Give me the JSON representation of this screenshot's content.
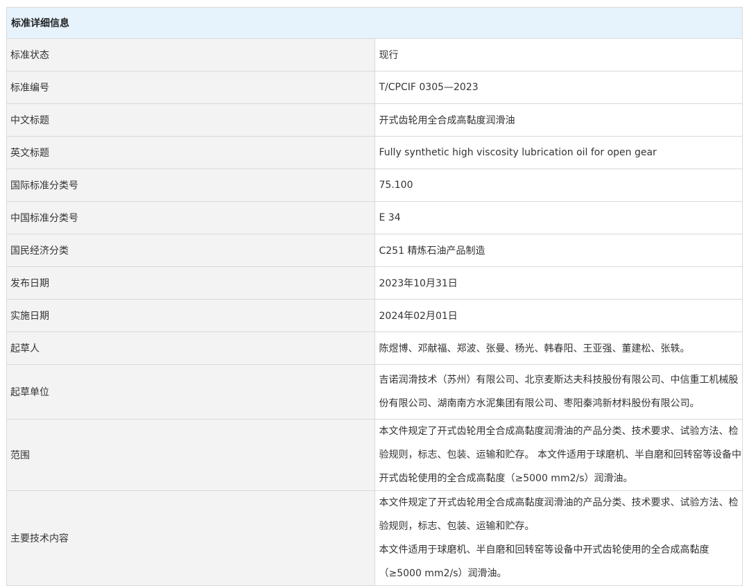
{
  "header": {
    "title": "标准详细信息"
  },
  "rows": [
    {
      "label": "标准状态",
      "value": "现行"
    },
    {
      "label": "标准编号",
      "value": "T/CPCIF 0305—2023"
    },
    {
      "label": "中文标题",
      "value": "开式齿轮用全合成高黏度润滑油"
    },
    {
      "label": "英文标题",
      "value": "Fully synthetic high viscosity lubrication oil for open gear"
    },
    {
      "label": "国际标准分类号",
      "value": "75.100"
    },
    {
      "label": "中国标准分类号",
      "value": "E 34"
    },
    {
      "label": "国民经济分类",
      "value": "C251 精炼石油产品制造"
    },
    {
      "label": "发布日期",
      "value": "2023年10月31日"
    },
    {
      "label": "实施日期",
      "value": "2024年02月01日"
    },
    {
      "label": "起草人",
      "value": "陈煜博、邓献福、郑波、张曼、杨光、韩春阳、王亚强、董建松、张轶。"
    },
    {
      "label": "起草单位",
      "value": "吉诺润滑技术（苏州）有限公司、北京麦斯达夫科技股份有限公司、中信重工机械股份有限公司、湖南南方水泥集团有限公司、枣阳秦鸿新材料股份有限公司。"
    },
    {
      "label": "范围",
      "value": "本文件规定了开式齿轮用全合成高黏度润滑油的产品分类、技术要求、试验方法、检验规则，标志、包装、运输和贮存。 本文件适用于球磨机、半自磨和回转窑等设备中开式齿轮使用的全合成高黏度（≥5000 mm2/s）润滑油。"
    },
    {
      "label": "主要技术内容",
      "lines": [
        "本文件规定了开式齿轮用全合成高黏度润滑油的产品分类、技术要求、试验方法、检验规则，标志、包装、运输和贮存。",
        "本文件适用于球磨机、半自磨和回转窑等设备中开式齿轮使用的全合成高黏度（≥5000 mm2/s）润滑油。"
      ]
    }
  ]
}
